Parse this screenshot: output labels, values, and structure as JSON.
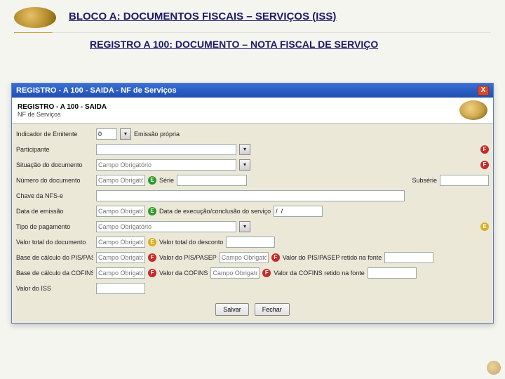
{
  "slide": {
    "title": "BLOCO A: DOCUMENTOS FISCAIS – SERVIÇOS (ISS)",
    "subtitle": "REGISTRO A 100: DOCUMENTO – NOTA FISCAL DE SERVIÇO"
  },
  "window": {
    "title": "REGISTRO - A 100 - SAIDA - NF de Serviços",
    "header": "REGISTRO - A 100 - SAIDA",
    "header_sub": "NF de Serviços",
    "close": "X"
  },
  "form": {
    "indicador_label": "Indicador de Emitente",
    "indicador_value": "0",
    "indicador_desc": "Emissão própria",
    "participante_label": "Participante",
    "situacao_label": "Situação do documento",
    "numero_label": "Número do documento",
    "serie_label": "Série",
    "subserie_label": "Subsérie",
    "chave_label": "Chave da NFS-e",
    "data_emissao_label": "Data de emissão",
    "data_exec_label": "Data de execução/conclusão do serviço",
    "data_sep": "/  /",
    "tipo_pag_label": "Tipo de pagamento",
    "valor_total_label": "Valor total do documento",
    "valor_desc_label": "Valor total do desconto",
    "base_pis_label": "Base de cálculo do PIS/PASEP",
    "valor_pis_label": "Valor do PIS/PASEP",
    "valor_pis_ret_label": "Valor do PIS/PASEP retido na fonte",
    "base_cofins_label": "Base de cálculo da COFINS",
    "valor_cofins_label": "Valor da COFINS",
    "valor_cofins_ret_label": "Valor da COFINS retido na fonte",
    "valor_iss_label": "Valor do ISS",
    "placeholder": "Campo Obrigatório",
    "badge_f": "F",
    "badge_e": "E"
  },
  "buttons": {
    "save": "Salvar",
    "close": "Fechar"
  }
}
